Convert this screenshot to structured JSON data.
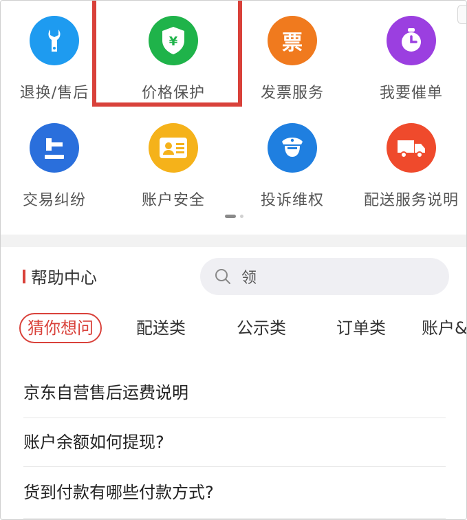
{
  "services": [
    {
      "label": "退换/售后",
      "icon": "wrench-icon",
      "color": "#1e9bf0"
    },
    {
      "label": "价格保护",
      "icon": "shield-yen-icon",
      "color": "#1fb34a"
    },
    {
      "label": "发票服务",
      "icon": "invoice-icon",
      "color": "#f07a1e",
      "glyph": "票"
    },
    {
      "label": "我要催单",
      "icon": "timer-icon",
      "color": "#9b3fe0"
    },
    {
      "label": "交易纠纷",
      "icon": "gavel-icon",
      "color": "#2a6fdc"
    },
    {
      "label": "账户安全",
      "icon": "id-card-icon",
      "color": "#f5b21a"
    },
    {
      "label": "投诉维权",
      "icon": "police-icon",
      "color": "#1f7fe0"
    },
    {
      "label": "配送服务说明",
      "icon": "truck-icon",
      "color": "#ef4a2c"
    }
  ],
  "help": {
    "title": "帮助中心",
    "search_placeholder": "领"
  },
  "tabs": [
    "猜你想问",
    "配送类",
    "公示类",
    "订单类",
    "账户&"
  ],
  "faq": [
    "京东自营售后运费说明",
    "账户余额如何提现?",
    "货到付款有哪些付款方式?"
  ],
  "colors": {
    "accent": "#d9413a",
    "band": "#f2f2f2"
  }
}
